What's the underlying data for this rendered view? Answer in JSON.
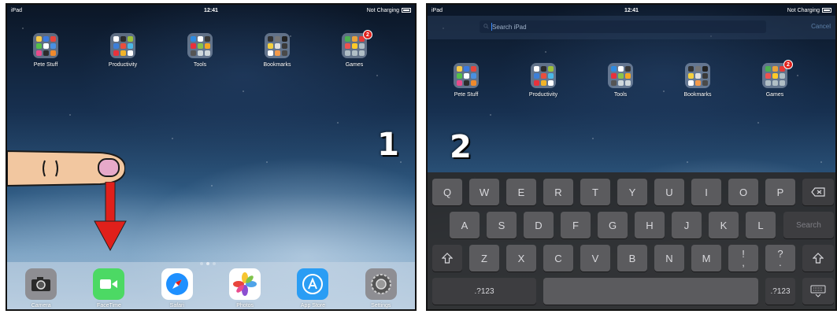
{
  "status_bar": {
    "carrier": "iPad",
    "time": "12:41",
    "charging": "Not Charging"
  },
  "folders": [
    {
      "label": "Pete Stuff",
      "badge": null,
      "icon_colors": [
        "#f6c94a",
        "#3b7ae0",
        "#e8453c",
        "#54c04a",
        "#ffffff",
        "#4a90e2",
        "#e94b8c",
        "#2c2c2c",
        "#f08a2c"
      ]
    },
    {
      "label": "Productivity",
      "badge": null,
      "icon_colors": [
        "#ffffff",
        "#2c2c2c",
        "#9ec23b",
        "#3c7fd9",
        "#ea4e3d",
        "#4ab8e8",
        "#e8323c",
        "#f2b429",
        "#ffffff"
      ]
    },
    {
      "label": "Tools",
      "badge": null,
      "icon_colors": [
        "#2f8be0",
        "#ffffff",
        "#3a3a3a",
        "#e8313c",
        "#8bc34a",
        "#f5a623",
        "#555555",
        "#cfd8dc",
        "#cfd8dc"
      ]
    },
    {
      "label": "Bookmarks",
      "badge": null,
      "icon_colors": [
        "#333333",
        "#777777",
        "#222222",
        "#f4d03f",
        "#e0e0e0",
        "#3a3a3a",
        "#ffffff",
        "#f2994a",
        "#4a4a4a"
      ]
    },
    {
      "label": "Games",
      "badge": "2",
      "icon_colors": [
        "#4caf50",
        "#e8a23a",
        "#e53935",
        "#ef5350",
        "#ffca28",
        "#b0bec5",
        "#b0bec5",
        "#b0bec5",
        "#b0bec5"
      ]
    }
  ],
  "dock": [
    {
      "label": "Camera",
      "icon": "camera-icon",
      "color": "#8e8e93"
    },
    {
      "label": "FaceTime",
      "icon": "facetime-icon",
      "color": "#4cd964"
    },
    {
      "label": "Safari",
      "icon": "safari-icon",
      "color": "#1e90ff"
    },
    {
      "label": "Photos",
      "icon": "photos-icon",
      "color": "#ffffff"
    },
    {
      "label": "App Store",
      "icon": "app-store-icon",
      "color": "#2a9df4"
    },
    {
      "label": "Settings",
      "icon": "settings-icon",
      "color": "#8e8e93"
    }
  ],
  "steps": {
    "first": "1",
    "second": "2"
  },
  "search": {
    "placeholder": "Search iPad",
    "cancel": "Cancel"
  },
  "keyboard": {
    "row1": [
      "Q",
      "W",
      "E",
      "R",
      "T",
      "Y",
      "U",
      "I",
      "O",
      "P"
    ],
    "row1_special": "backspace-icon",
    "row2": [
      "A",
      "S",
      "D",
      "F",
      "G",
      "H",
      "J",
      "K",
      "L"
    ],
    "row2_action": "Search",
    "row3": [
      "Z",
      "X",
      "C",
      "V",
      "B",
      "N",
      "M"
    ],
    "row3_punct": [
      {
        "top": "!",
        "bottom": ","
      },
      {
        "top": "?",
        "bottom": "."
      }
    ],
    "row3_special": "shift-icon",
    "row4_left": ".?123",
    "row4_right": ".?123",
    "row4_special": "keyboard-dismiss-icon"
  },
  "colors": {
    "arrow": "#e0201b",
    "badge": "#e0201b",
    "key": "#5b5b5e",
    "keyboard_bg": "#2a2a2c"
  }
}
